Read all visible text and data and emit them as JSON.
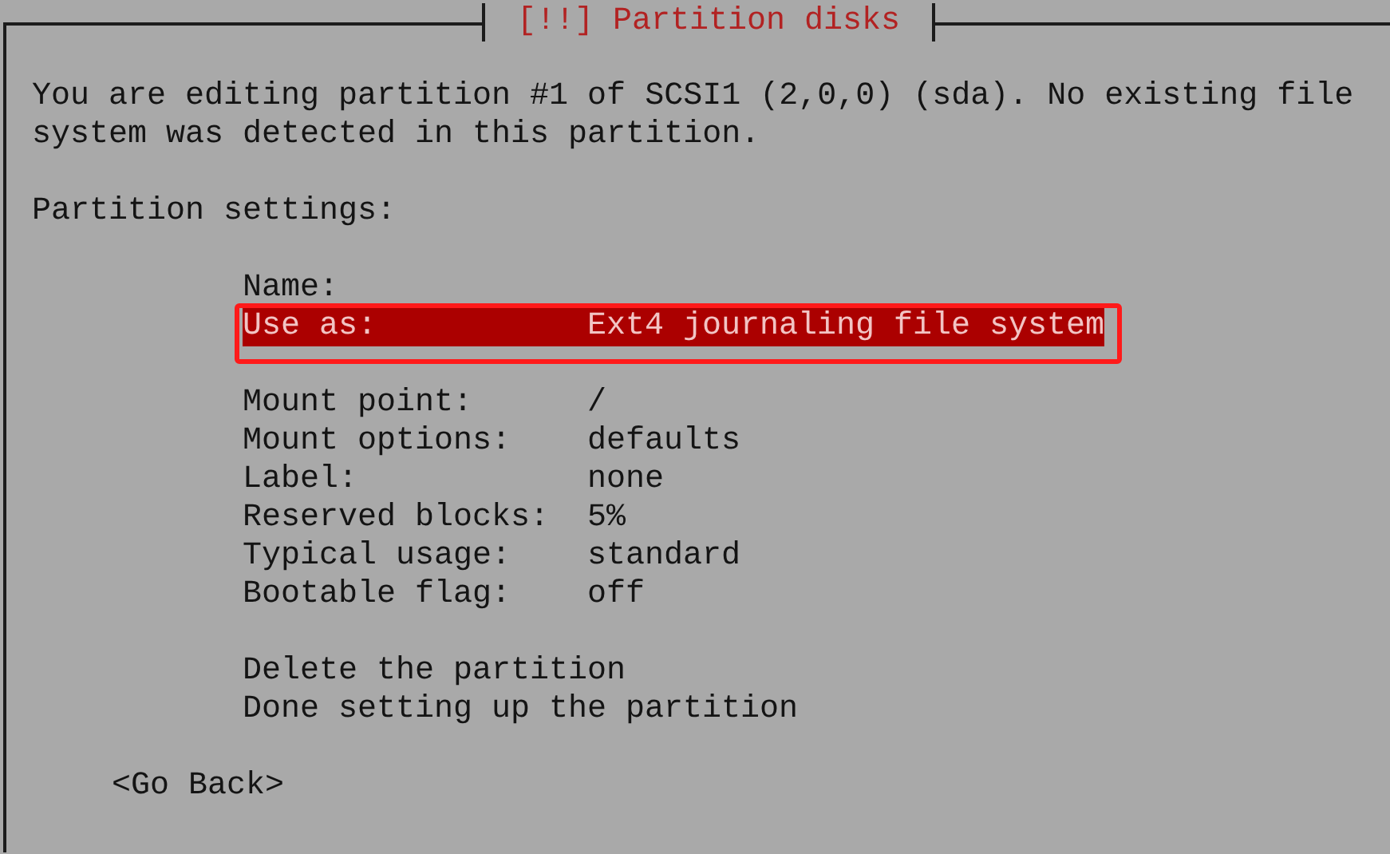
{
  "dialog": {
    "title": "[!!] Partition disks",
    "description": "You are editing partition #1 of SCSI1 (2,0,0) (sda). No existing file system was detected in this partition.",
    "section_label": "Partition settings:",
    "setting_groups": [
      {
        "items": [
          {
            "label": "Name:",
            "selected": false,
            "annotated": false
          },
          {
            "label": "Use as:",
            "value": "Ext4 journaling file system",
            "selected": true,
            "annotated": true
          }
        ]
      },
      {
        "items": [
          {
            "label": "Mount point:",
            "value": "/",
            "selected": false,
            "annotated": false
          },
          {
            "label": "Mount options:",
            "value": "defaults",
            "selected": false,
            "annotated": false
          },
          {
            "label": "Label:",
            "value": "none",
            "selected": false,
            "annotated": false
          },
          {
            "label": "Reserved blocks:",
            "value": "5%",
            "selected": false,
            "annotated": false
          },
          {
            "label": "Typical usage:",
            "value": "standard",
            "selected": false,
            "annotated": false
          },
          {
            "label": "Bootable flag:",
            "value": "off",
            "selected": false,
            "annotated": false
          }
        ]
      }
    ],
    "actions": [
      {
        "label": "Delete the partition",
        "selected": false
      },
      {
        "label": "Done setting up the partition",
        "selected": false
      }
    ],
    "back_button": "<Go Back>"
  }
}
